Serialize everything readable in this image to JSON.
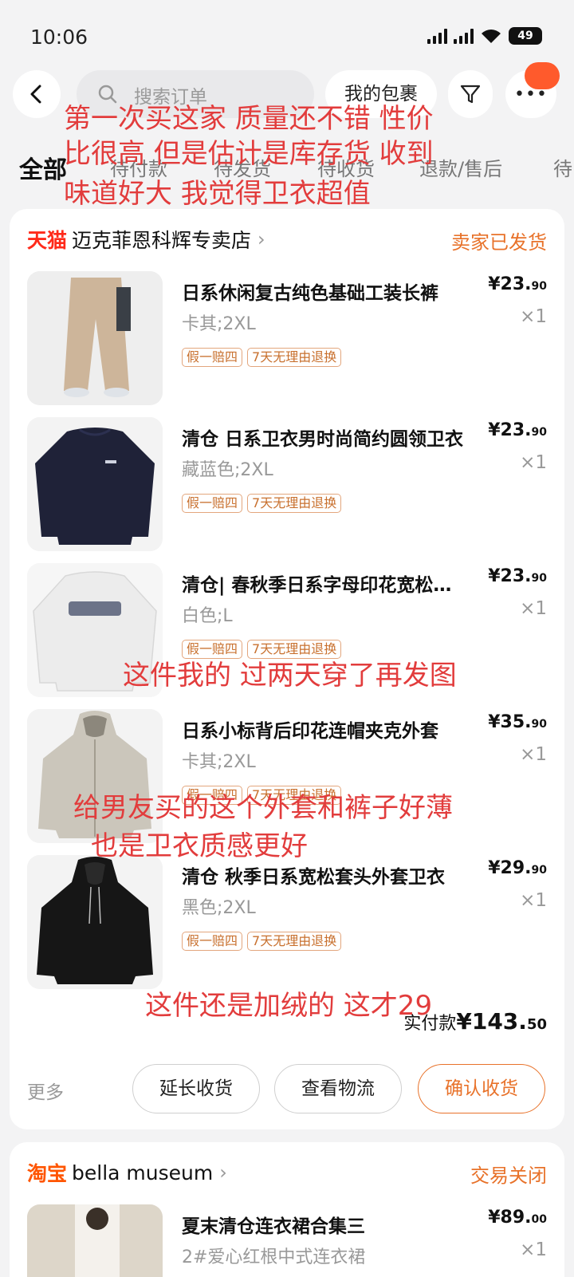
{
  "status_bar": {
    "time": "10:06",
    "battery": "49"
  },
  "top_nav": {
    "search_placeholder": "搜索订单",
    "parcel_button": "我的包裹",
    "more_icon": "more-dots-icon"
  },
  "tabs": [
    "全部",
    "待付款",
    "待发货",
    "待收货",
    "退款/售后",
    "待"
  ],
  "order1": {
    "platform": "天猫",
    "store_name": "迈克菲恩科辉专卖店",
    "status": "卖家已发货",
    "items": [
      {
        "title": "日系休闲复古纯色基础工装长裤",
        "price_main": "¥23.",
        "price_dec": "90",
        "sku": "卡其;2XL",
        "qty": "×1",
        "tags": [
          "假一赔四",
          "7天无理由退换"
        ]
      },
      {
        "title": "清仓  日系卫衣男时尚简约圆领卫衣",
        "price_main": "¥23.",
        "price_dec": "90",
        "sku": "藏蓝色;2XL",
        "qty": "×1",
        "tags": [
          "假一赔四",
          "7天无理由退换"
        ]
      },
      {
        "title": "清仓|  春秋季日系字母印花宽松卫衣",
        "price_main": "¥23.",
        "price_dec": "90",
        "sku": "白色;L",
        "qty": "×1",
        "tags": [
          "假一赔四",
          "7天无理由退换"
        ]
      },
      {
        "title": "日系小标背后印花连帽夹克外套",
        "price_main": "¥35.",
        "price_dec": "90",
        "sku": "卡其;2XL",
        "qty": "×1",
        "tags": [
          "假一赔四",
          "7天无理由退换"
        ]
      },
      {
        "title": "清仓  秋季日系宽松套头外套卫衣",
        "price_main": "¥29.",
        "price_dec": "90",
        "sku": "黑色;2XL",
        "qty": "×1",
        "tags": [
          "假一赔四",
          "7天无理由退换"
        ]
      }
    ],
    "paid_label": "实付款",
    "paid_main": "¥143.",
    "paid_dec": "50",
    "more_label": "更多",
    "buttons": {
      "extend": "延长收货",
      "logistics": "查看物流",
      "confirm": "确认收货"
    }
  },
  "order2": {
    "platform": "淘宝",
    "store_name": "bella  museum",
    "status": "交易关闭",
    "item": {
      "title": "夏末清仓连衣裙合集三",
      "price_main": "¥89.",
      "price_dec": "00",
      "sku": "2#爱心红根中式连衣裙",
      "qty": "×1"
    }
  },
  "annotations": {
    "line1": "第一次买这家  质量还不错  性价",
    "line2": "比很高  但是估计是库存货  收到",
    "line3": "味道好大  我觉得卫衣超值",
    "note_white": "这件我的  过两天穿了再发图",
    "note_jacket_1": "给男友买的这个外套和裤子好薄",
    "note_jacket_2": "也是卫衣质感更好",
    "note_black": "这件还是加绒的  这才29"
  },
  "colors": {
    "accent": "#e8722a",
    "tmall": "#ff2a1a",
    "taobao": "#ff5500",
    "annotation": "#e23c3c"
  }
}
